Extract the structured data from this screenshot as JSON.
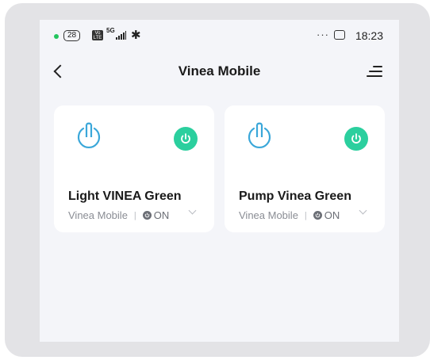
{
  "status_bar": {
    "badge": "28",
    "vo_label": "VoLTE",
    "network": "5G",
    "more": "···",
    "time": "18:23",
    "dot_color": "#22c55e"
  },
  "nav": {
    "title": "Vinea Mobile",
    "back_icon": "chevron-left-icon",
    "menu_icon": "menu-icon"
  },
  "devices": [
    {
      "name": "Light VINEA Green",
      "group": "Vinea Mobile",
      "status": "ON"
    },
    {
      "name": "Pump Vinea Green",
      "group": "Vinea Mobile",
      "status": "ON"
    }
  ],
  "colors": {
    "accent": "#2bcf9e",
    "power_outline": "#3aa7d9",
    "background": "#f4f5f9"
  }
}
